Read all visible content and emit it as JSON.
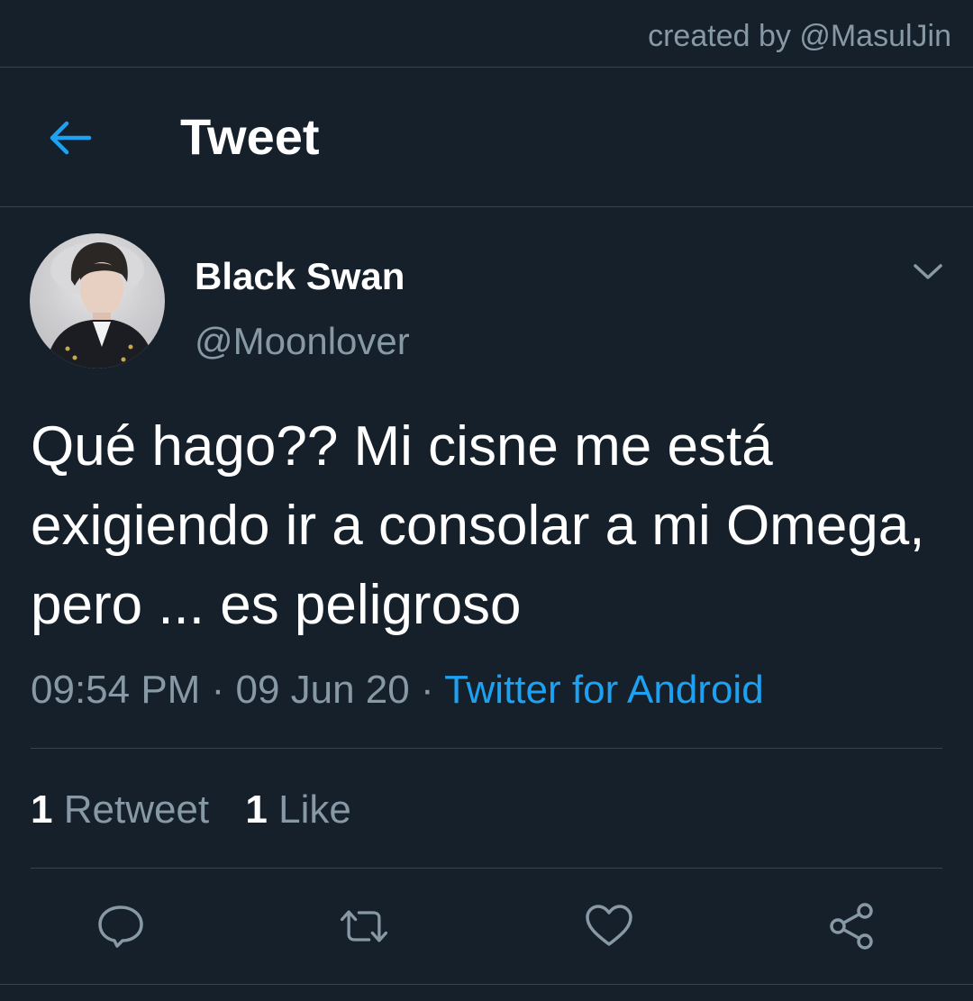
{
  "credit": "created by @MasulJin",
  "header": {
    "back_icon": "arrow-left-icon",
    "title": "Tweet"
  },
  "tweet": {
    "author_name": "Black Swan",
    "author_handle": "@Moonlover",
    "menu_icon": "chevron-down-icon",
    "text": "Qué hago?? Mi cisne me está exigiendo ir a consolar a mi Omega, pero ... es peligroso",
    "time": "09:54 PM",
    "separator": "·",
    "date": "09 Jun 20",
    "source": "Twitter for Android"
  },
  "stats": {
    "retweets_count": "1",
    "retweets_label": "Retweet",
    "likes_count": "1",
    "likes_label": "Like"
  },
  "actions": [
    {
      "icon": "reply-icon"
    },
    {
      "icon": "retweet-icon"
    },
    {
      "icon": "heart-icon"
    },
    {
      "icon": "share-icon"
    }
  ],
  "colors": {
    "background": "#15202b",
    "divider": "#38444d",
    "secondary_text": "#8899a6",
    "accent": "#1da1f2",
    "primary_text": "#ffffff"
  }
}
